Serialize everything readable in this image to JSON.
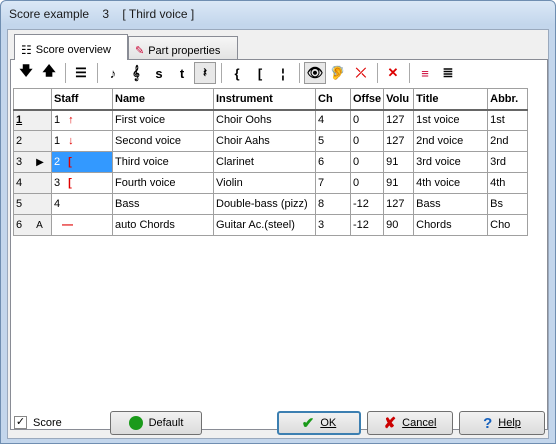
{
  "window": {
    "title_parts": [
      "Score example",
      "3",
      "[ Third voice ]"
    ]
  },
  "tabs": [
    {
      "label": "Score overview",
      "icon": "score-overview-icon"
    },
    {
      "label": "Part properties",
      "icon": "part-properties-icon"
    }
  ],
  "toolbar": {
    "buttons": [
      {
        "name": "move-down-icon",
        "glyph": "🡇"
      },
      {
        "name": "move-up-icon",
        "glyph": "🡅"
      },
      {
        "name": "list-icon",
        "glyph": "☰"
      },
      {
        "name": "note-icon",
        "glyph": "♪"
      },
      {
        "name": "clef-icon",
        "glyph": "𝄞"
      },
      {
        "name": "s-label",
        "glyph": "s"
      },
      {
        "name": "t-label",
        "glyph": "t"
      },
      {
        "name": "rest-icon",
        "glyph": "𝄽"
      },
      {
        "name": "brace-icon",
        "glyph": "{"
      },
      {
        "name": "bracket-icon",
        "glyph": "["
      },
      {
        "name": "barline-icon",
        "glyph": "¦"
      },
      {
        "name": "eye-icon",
        "glyph": "👁"
      },
      {
        "name": "ear-icon",
        "glyph": "🦻"
      },
      {
        "name": "mute-icon",
        "glyph": "⤫"
      },
      {
        "name": "delete-icon",
        "glyph": "✕"
      },
      {
        "name": "staff-color-icon",
        "glyph": "≡"
      },
      {
        "name": "staff-lines-icon",
        "glyph": "≣"
      }
    ]
  },
  "grid": {
    "columns": [
      "",
      "Staff",
      "Name",
      "Instrument",
      "Ch",
      "Offse",
      "Volu",
      "Title",
      "Abbr."
    ],
    "rows": [
      {
        "num": "1",
        "mark": "",
        "staff": "1",
        "staff_sym": "↑",
        "name": "First voice",
        "instrument": "Choir Oohs",
        "ch": "4",
        "offset": "0",
        "vol": "127",
        "title": "1st voice",
        "abbr": "1st"
      },
      {
        "num": "2",
        "mark": "",
        "staff": "1",
        "staff_sym": "↓",
        "name": "Second voice",
        "instrument": "Choir Aahs",
        "ch": "5",
        "offset": "0",
        "vol": "127",
        "title": "2nd voice",
        "abbr": "2nd"
      },
      {
        "num": "3",
        "mark": "▶",
        "staff": "2",
        "staff_sym": "[",
        "name": "Third voice",
        "instrument": "Clarinet",
        "ch": "6",
        "offset": "0",
        "vol": "91",
        "title": "3rd voice",
        "abbr": "3rd"
      },
      {
        "num": "4",
        "mark": "",
        "staff": "3",
        "staff_sym": "[",
        "name": "Fourth voice",
        "instrument": "Violin",
        "ch": "7",
        "offset": "0",
        "vol": "91",
        "title": "4th voice",
        "abbr": "4th"
      },
      {
        "num": "5",
        "mark": "",
        "staff": "4",
        "staff_sym": "",
        "name": "Bass",
        "instrument": "Double-bass (pizz)",
        "ch": "8",
        "offset": "-12",
        "vol": "127",
        "title": "Bass",
        "abbr": "Bs"
      },
      {
        "num": "6",
        "mark": "A",
        "staff": "",
        "staff_sym": "—",
        "name": "auto Chords",
        "instrument": "Guitar Ac.(steel)",
        "ch": "3",
        "offset": "-12",
        "vol": "90",
        "title": "Chords",
        "abbr": "Cho"
      }
    ]
  },
  "bottom": {
    "score_checkbox": {
      "label": "Score",
      "checked": true
    },
    "default_label": "Default",
    "ok_label": "OK",
    "cancel_label": "Cancel",
    "help_label": "Help"
  }
}
